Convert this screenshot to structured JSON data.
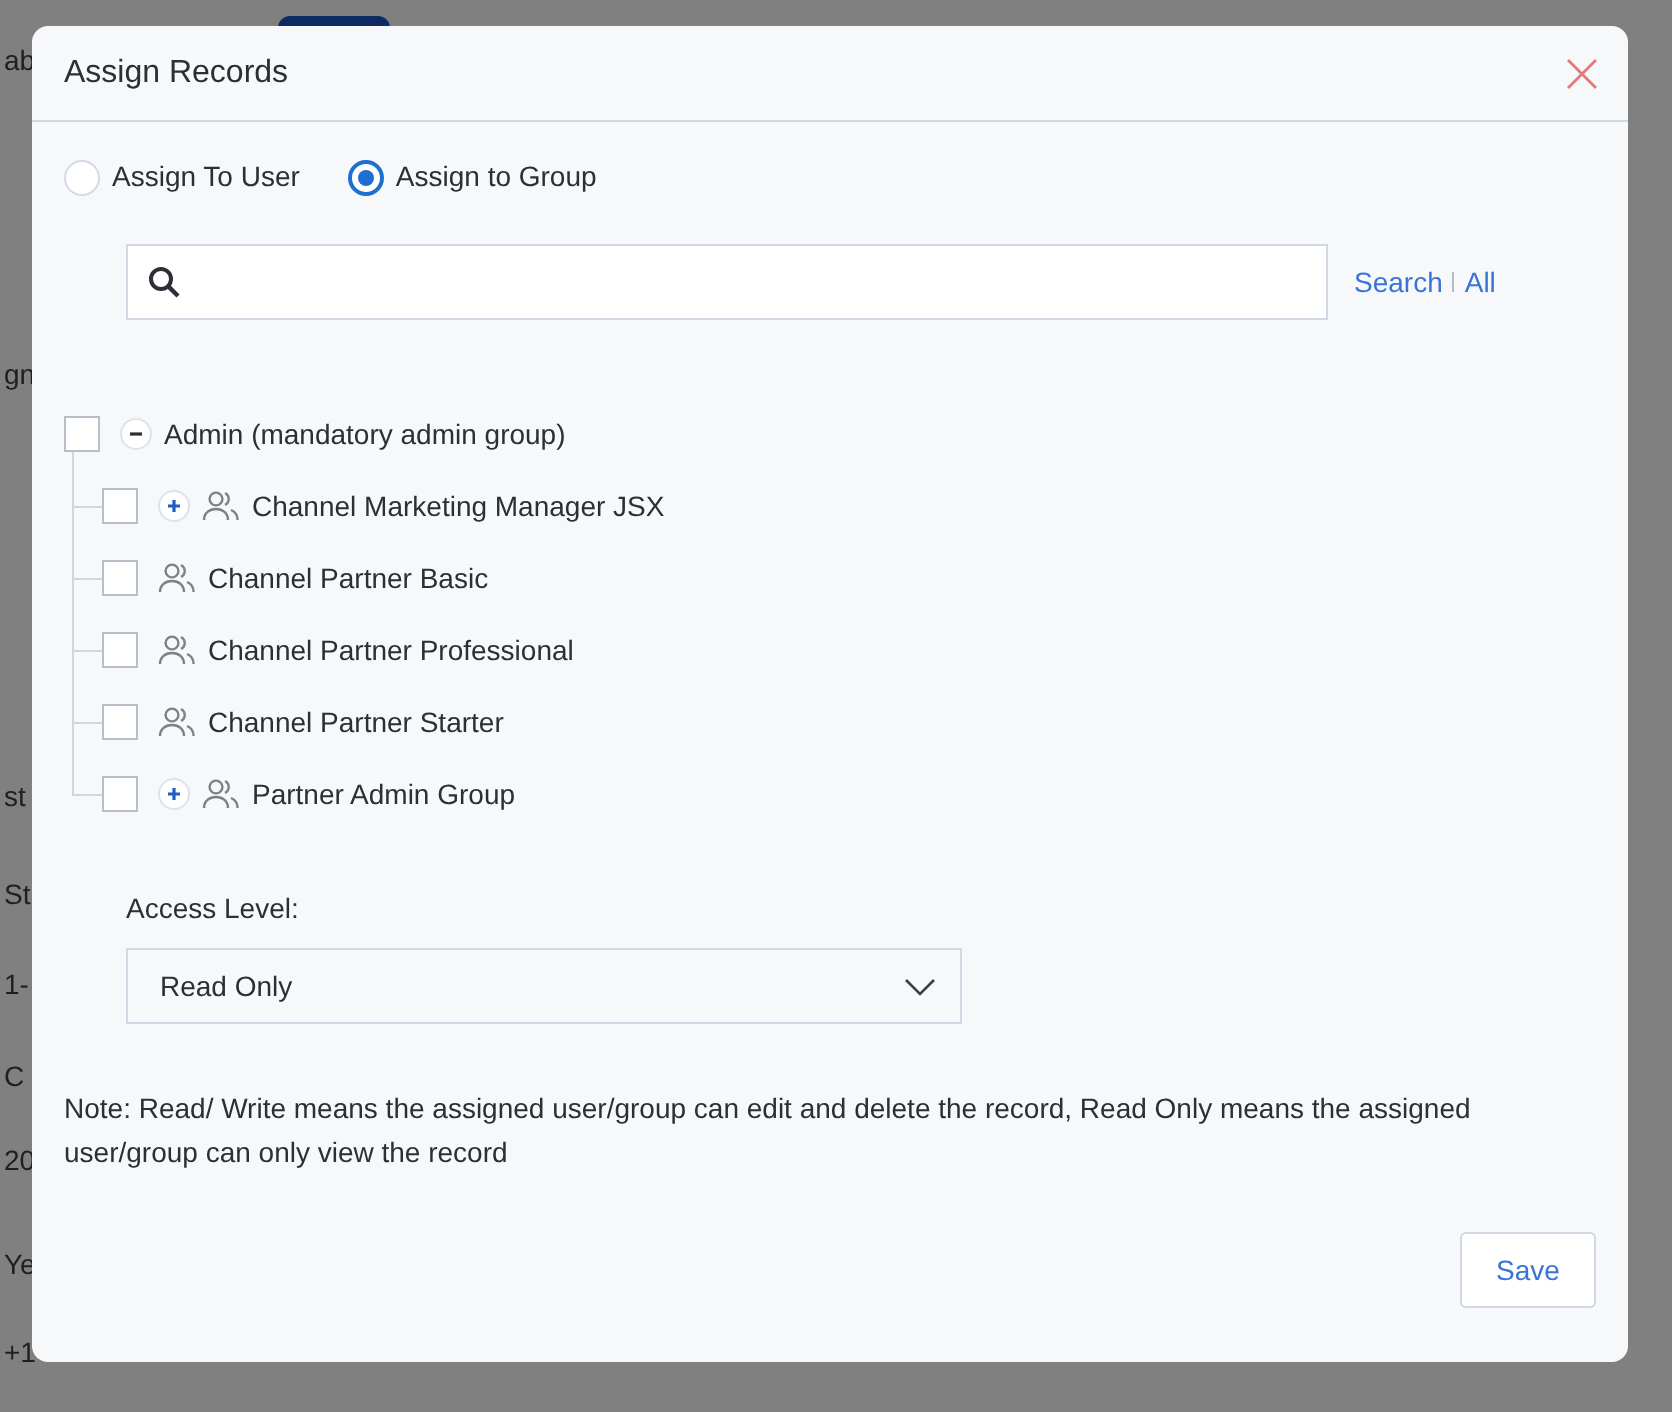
{
  "background": {
    "fragments": [
      "ab",
      "gn",
      "st",
      "St",
      "1-",
      "C",
      "20",
      "Ye",
      "+1"
    ]
  },
  "dialog": {
    "title": "Assign Records",
    "assign_options": [
      {
        "label": "Assign To User",
        "selected": false
      },
      {
        "label": "Assign to Group",
        "selected": true
      }
    ],
    "search_links": [
      "Search",
      "All"
    ],
    "tree": [
      {
        "kind": "category",
        "label": "Admin (mandatory admin group)",
        "checked": false,
        "expanded": true,
        "children": [
          {
            "kind": "group",
            "label": "Channel Marketing Manager JSX",
            "checked": false,
            "expanded": false
          },
          {
            "kind": "group",
            "label": "Channel Partner Basic",
            "checked": false
          },
          {
            "kind": "group",
            "label": "Channel Partner Professional",
            "checked": false
          },
          {
            "kind": "group",
            "label": "Channel Partner Starter",
            "checked": false
          },
          {
            "kind": "group",
            "label": "Partner Admin Group",
            "checked": false,
            "expanded": false
          }
        ]
      }
    ],
    "access_level": {
      "label": "Access Level:",
      "value": "Read Only"
    },
    "note": "Note: Read/ Write means the assigned user/group can edit and delete the record, Read Only means the assigned user/group can only view the record",
    "save_button": "Save"
  }
}
